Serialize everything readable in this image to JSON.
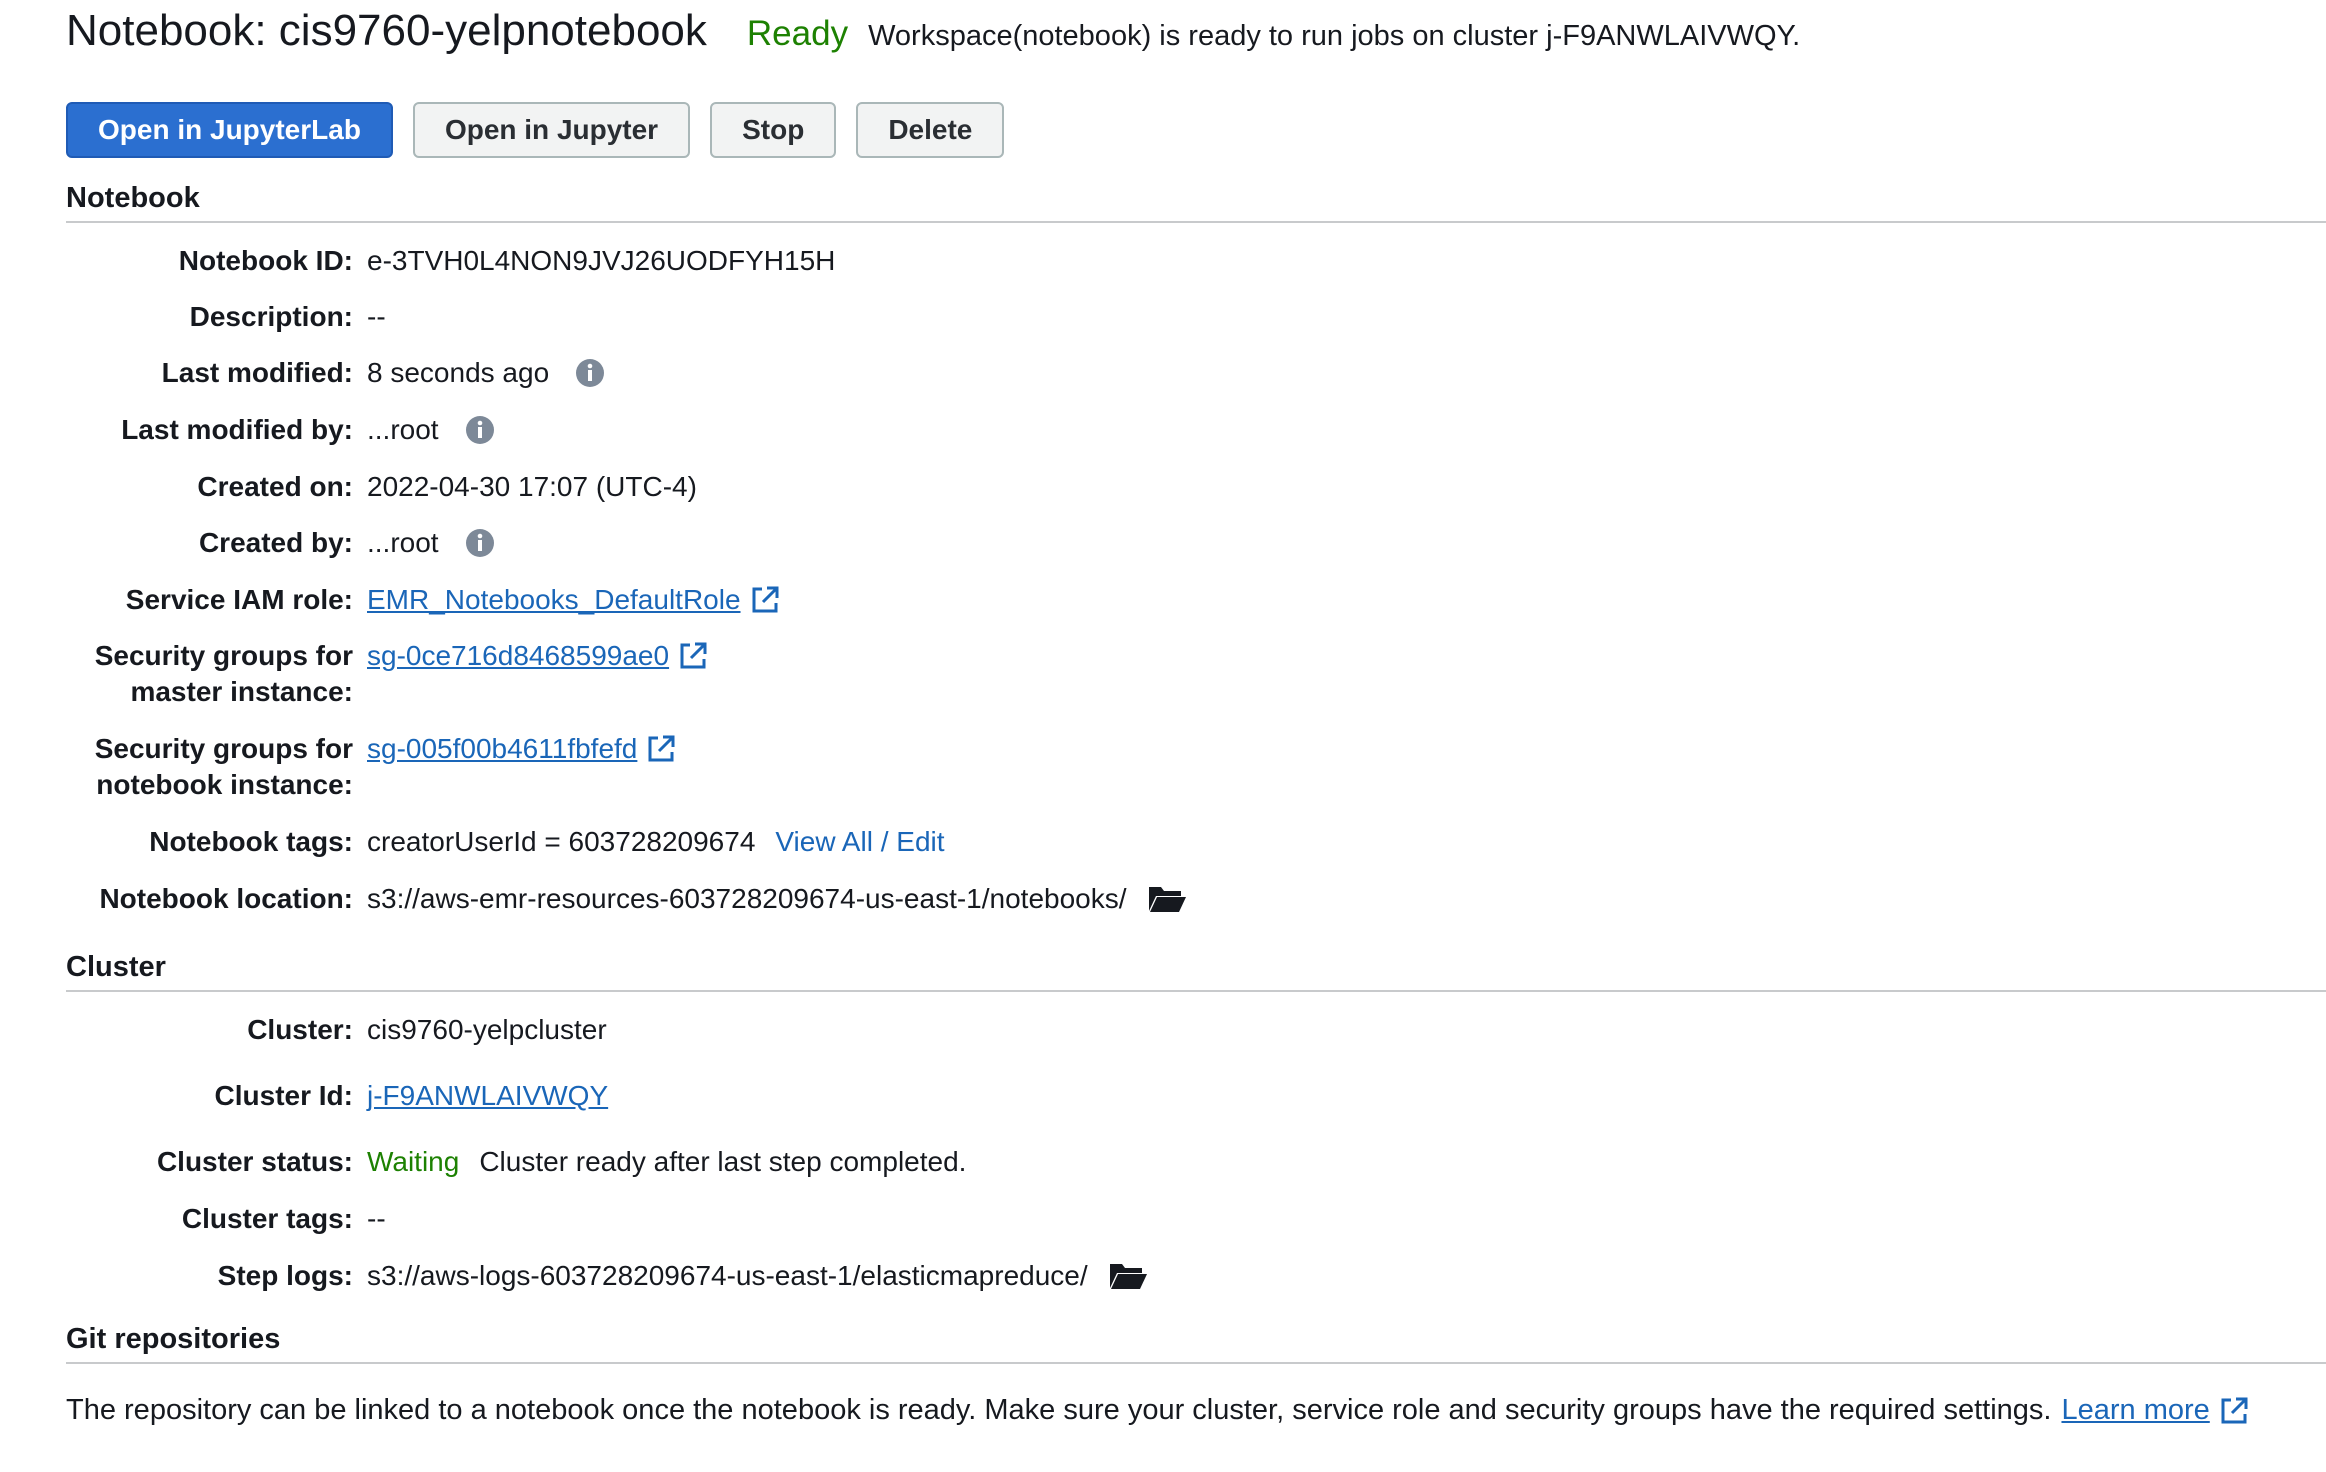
{
  "header": {
    "title": "Notebook: cis9760-yelpnotebook",
    "status": "Ready",
    "status_message": "Workspace(notebook) is ready to run jobs on cluster j-F9ANWLAIVWQY."
  },
  "buttons": {
    "open_jupyterlab": "Open in JupyterLab",
    "open_jupyter": "Open in Jupyter",
    "stop": "Stop",
    "delete": "Delete"
  },
  "notebook": {
    "section_title": "Notebook",
    "fields": {
      "notebook_id": {
        "label": "Notebook ID:",
        "value": "e-3TVH0L4NON9JVJ26UODFYH15H"
      },
      "description": {
        "label": "Description:",
        "value": "--"
      },
      "last_modified": {
        "label": "Last modified:",
        "value": "8 seconds ago"
      },
      "last_modified_by": {
        "label": "Last modified by:",
        "value": "...root"
      },
      "created_on": {
        "label": "Created on:",
        "value": "2022-04-30 17:07 (UTC-4)"
      },
      "created_by": {
        "label": "Created by:",
        "value": "...root"
      },
      "service_iam_role": {
        "label": "Service IAM role:",
        "value": "EMR_Notebooks_DefaultRole"
      },
      "sg_master": {
        "label_line1": "Security groups for",
        "label_line2": "master instance:",
        "value": "sg-0ce716d8468599ae0"
      },
      "sg_notebook": {
        "label_line1": "Security groups for",
        "label_line2": "notebook instance:",
        "value": "sg-005f00b4611fbfefd"
      },
      "notebook_tags": {
        "label": "Notebook tags:",
        "value": "creatorUserId = 603728209674",
        "action": "View All / Edit"
      },
      "notebook_location": {
        "label": "Notebook location:",
        "value": "s3://aws-emr-resources-603728209674-us-east-1/notebooks/"
      }
    }
  },
  "cluster": {
    "section_title": "Cluster",
    "fields": {
      "cluster": {
        "label": "Cluster:",
        "value": "cis9760-yelpcluster"
      },
      "cluster_id": {
        "label": "Cluster Id:",
        "value": "j-F9ANWLAIVWQY"
      },
      "cluster_status": {
        "label": "Cluster status:",
        "status": "Waiting",
        "message": "Cluster ready after last step completed."
      },
      "cluster_tags": {
        "label": "Cluster tags:",
        "value": "--"
      },
      "step_logs": {
        "label": "Step logs:",
        "value": "s3://aws-logs-603728209674-us-east-1/elasticmapreduce/"
      }
    }
  },
  "git": {
    "section_title": "Git repositories",
    "text": "The repository can be linked to a notebook once the notebook is ready. Make sure your cluster, service role and security groups have the required settings.",
    "learn_more": "Learn more"
  },
  "icons": {
    "info": "info-icon",
    "external_link": "external-link-icon",
    "folder": "folder-open-icon"
  },
  "colors": {
    "status_green": "#1d8102",
    "link_blue": "#1a66b8",
    "primary_button": "#2b6fd0"
  }
}
